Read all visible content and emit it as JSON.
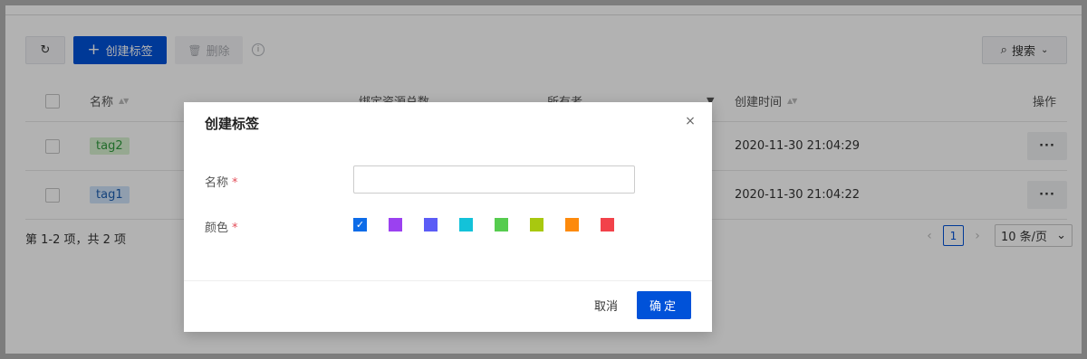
{
  "toolbar": {
    "refresh_icon": "refresh-icon",
    "refresh_glyph": "↻",
    "create_glyph": "+",
    "create_label": "创建标签",
    "delete_glyph": "🗑",
    "delete_label": "删除",
    "info_glyph": "i",
    "search_glyph": "⌕",
    "search_label": "搜索",
    "search_chevron": "⌄"
  },
  "table": {
    "columns": {
      "name": "名称",
      "bound": "绑定资源总数",
      "owner": "所有者",
      "filter_glyph": "▼",
      "created": "创建时间",
      "operation": "操作"
    },
    "sort_glyph": "▲▼",
    "rows": [
      {
        "tag": "tag2",
        "tag_color": "#2f9b3d",
        "created": "2020-11-30 21:04:29",
        "more": "···"
      },
      {
        "tag": "tag1",
        "tag_color": "#1d5fb2",
        "created": "2020-11-30 21:04:22",
        "more": "···"
      }
    ]
  },
  "footer": {
    "summary": "第 1-2 项，共 2 项",
    "prev": "‹",
    "page": "1",
    "next": "›",
    "page_size": "10 条/页",
    "page_size_chevron": "⌄"
  },
  "modal": {
    "title": "创建标签",
    "close": "×",
    "name_label": "名称",
    "color_label": "颜色",
    "required_mark": "*",
    "name_value": "",
    "check_glyph": "✓",
    "colors": [
      "#0d6ce8",
      "#9b41f0",
      "#5b5cf6",
      "#13c2d9",
      "#56cc4f",
      "#a8c80f",
      "#fd8a0c",
      "#f2424a"
    ],
    "selected_color_index": 0,
    "cancel_label": "取消",
    "ok_label": "确定"
  }
}
